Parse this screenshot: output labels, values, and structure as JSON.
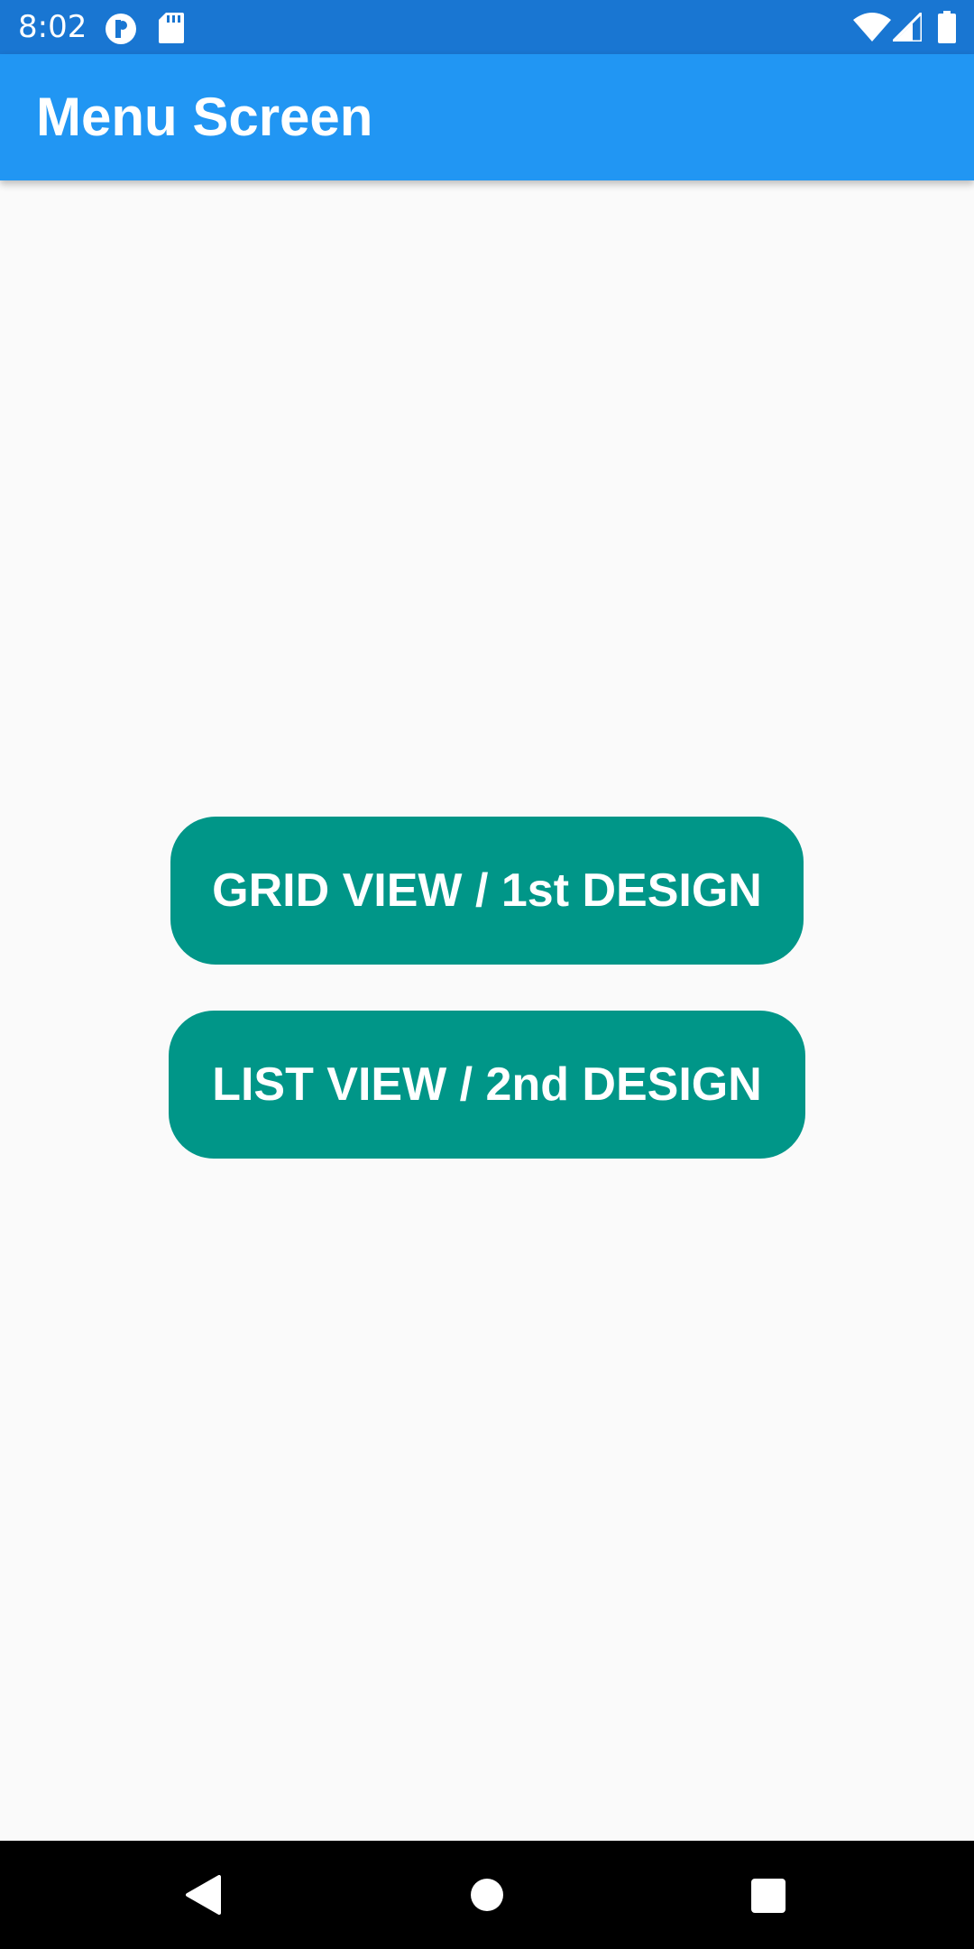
{
  "status_bar": {
    "time": "8:02",
    "left_icons": [
      "notification-app-icon",
      "sd-card-icon"
    ],
    "right_icons": [
      "wifi-icon",
      "cellular-signal-icon",
      "battery-icon"
    ],
    "background_color": "#1976d2"
  },
  "app_bar": {
    "title": "Menu Screen",
    "background_color": "#2196f3"
  },
  "menu": {
    "buttons": [
      {
        "label": "GRID VIEW / 1st DESIGN"
      },
      {
        "label": "LIST VIEW / 2nd DESIGN"
      }
    ],
    "button_color": "#009688"
  },
  "nav_bar": {
    "buttons": [
      "back-icon",
      "home-icon",
      "recents-icon"
    ]
  }
}
